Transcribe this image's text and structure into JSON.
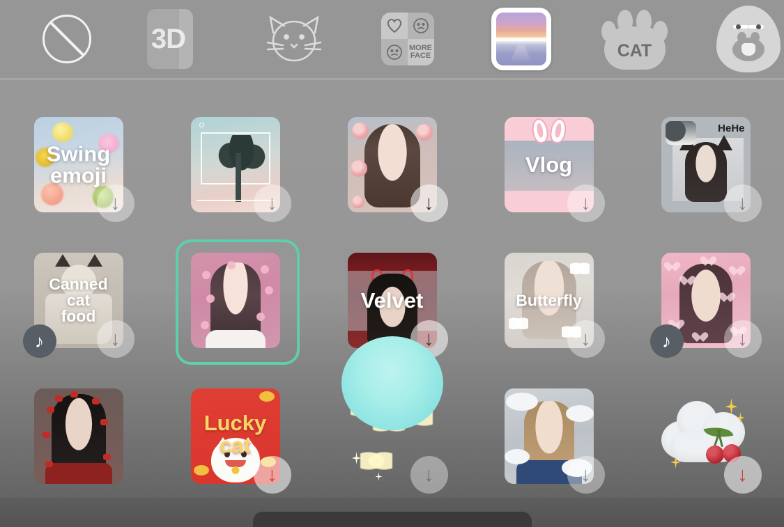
{
  "screen": {
    "app": "camera-filter-picker",
    "background_color": "#969696",
    "selection_color": "#5ecfae",
    "touch_indicator_color": "#8fe4e2"
  },
  "category_bar": {
    "items": [
      {
        "id": "none",
        "icon": "no-filter-icon",
        "label": "",
        "selected": false
      },
      {
        "id": "3d",
        "icon": "3d-icon",
        "label": "3D",
        "selected": false
      },
      {
        "id": "cat",
        "icon": "cat-sketch-icon",
        "label": "",
        "selected": false
      },
      {
        "id": "more-face",
        "icon": "more-face-icon",
        "label": "MORE FACE",
        "selected": false
      },
      {
        "id": "gallery",
        "icon": "gallery-icon",
        "label": "",
        "selected": true
      },
      {
        "id": "cat-paw",
        "icon": "cat-paw-icon",
        "label": "CAT",
        "selected": false
      },
      {
        "id": "funny",
        "icon": "funny-face-icon",
        "label": "",
        "selected": false
      },
      {
        "id": "sparkle",
        "icon": "sparkle-icon",
        "label": "",
        "selected": false
      }
    ],
    "more_face_lines": [
      "MORE",
      "FACE"
    ]
  },
  "grid": {
    "columns": 5,
    "rows": 3,
    "items": [
      {
        "id": "swing-emoji",
        "label": "Swing\nemoji",
        "label_lines": [
          "Swing",
          "emoji"
        ],
        "selected": false,
        "has_download": true,
        "download_state": "dim",
        "has_music": false,
        "art": "swing"
      },
      {
        "id": "palm-frame",
        "label": "",
        "label_lines": [],
        "selected": false,
        "has_download": true,
        "download_state": "dim",
        "has_music": false,
        "art": "palm"
      },
      {
        "id": "rose",
        "label": "",
        "label_lines": [],
        "selected": false,
        "has_download": true,
        "download_state": "normal",
        "has_music": false,
        "art": "rose"
      },
      {
        "id": "vlog",
        "label": "Vlog",
        "label_lines": [
          "Vlog"
        ],
        "selected": false,
        "has_download": true,
        "download_state": "dim",
        "has_music": false,
        "art": "vlog"
      },
      {
        "id": "hehe-cat",
        "label": "HeHe",
        "label_lines": [],
        "selected": false,
        "has_download": true,
        "download_state": "dim",
        "has_music": false,
        "art": "hehe"
      },
      {
        "id": "canned-cat-food",
        "label": "Canned\ncat\nfood",
        "label_lines": [
          "Canned",
          "cat",
          "food"
        ],
        "selected": false,
        "has_download": true,
        "download_state": "dim",
        "has_music": true,
        "art": "canned"
      },
      {
        "id": "sakura-girl",
        "label": "",
        "label_lines": [],
        "selected": true,
        "has_download": false,
        "download_state": "none",
        "has_music": false,
        "art": "selected"
      },
      {
        "id": "velvet",
        "label": "Velvet",
        "label_lines": [
          "Velvet"
        ],
        "selected": false,
        "has_download": true,
        "download_state": "normal",
        "has_music": false,
        "art": "velvet"
      },
      {
        "id": "butterfly",
        "label": "Butterfly",
        "label_lines": [
          "Butterfly"
        ],
        "selected": false,
        "has_download": true,
        "download_state": "dim",
        "has_music": false,
        "art": "butterfly"
      },
      {
        "id": "pink-hearts",
        "label": "",
        "label_lines": [],
        "selected": false,
        "has_download": true,
        "download_state": "dim",
        "has_music": true,
        "art": "hearts"
      },
      {
        "id": "red-petals",
        "label": "",
        "label_lines": [],
        "selected": false,
        "has_download": false,
        "download_state": "none",
        "has_music": false,
        "art": "redlip"
      },
      {
        "id": "lucky-cat",
        "label": "Lucky\ncat",
        "label_lines": [
          "Lucky",
          "cat"
        ],
        "selected": false,
        "has_download": true,
        "download_state": "red",
        "has_music": false,
        "art": "lucky"
      },
      {
        "id": "gold-butterflies",
        "label": "",
        "label_lines": [],
        "selected": false,
        "has_download": true,
        "download_state": "dim",
        "has_music": false,
        "art": "butterflies"
      },
      {
        "id": "cloud-girl",
        "label": "",
        "label_lines": [],
        "selected": false,
        "has_download": true,
        "download_state": "dim",
        "has_music": false,
        "art": "cloudgirl"
      },
      {
        "id": "cherry-cloud",
        "label": "",
        "label_lines": [],
        "selected": false,
        "has_download": true,
        "download_state": "red",
        "has_music": false,
        "art": "cherrycloud"
      }
    ]
  },
  "icons": {
    "download_arrow": "↓",
    "music_note": "♪"
  },
  "bottom": {
    "home_indicator": true
  }
}
